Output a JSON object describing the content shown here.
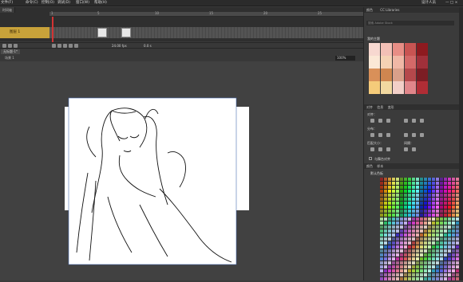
{
  "menubar": {
    "items": [
      "文件(F)",
      "命令(C)",
      "控制(O)",
      "调试(D)",
      "窗口(W)",
      "帮助(H)"
    ],
    "right_label": "设计人员"
  },
  "timeline": {
    "tab_label": "时间轴",
    "ruler_numbers": [
      "1",
      "5",
      "10",
      "15",
      "20",
      "25"
    ],
    "layer_name": "图层 1",
    "fps": "24.00 fps",
    "time": "0.0 s"
  },
  "scene": {
    "tab_label": "无标题-1*",
    "breadcrumb": "场景 1",
    "zoom": "100%"
  },
  "right_panel": {
    "library_tabs": [
      "颜色",
      "CC Libraries"
    ],
    "search_placeholder": "搜索 Adobe Stock",
    "palette_title": "我的主题",
    "align_tabs": [
      "对齐",
      "信息",
      "变形"
    ],
    "align_labels": [
      "对齐：",
      "分布：",
      "匹配大小：",
      "间隔："
    ],
    "align_checkbox": "与舞台对齐",
    "swatches_tabs": [
      "颜色",
      "样本"
    ],
    "swatches_title": "默认色板"
  },
  "colors": {
    "palette": [
      [
        "#f7d8d0",
        "#f3c0b6",
        "#e88e86",
        "#c95452",
        "#8e1a1f"
      ],
      [
        "#fbe8d6",
        "#f5d2b4",
        "#f0b8a6",
        "#d46968",
        "#a0303a"
      ],
      [
        "#d99059",
        "#cf8650",
        "#d9a08a",
        "#b5484b",
        "#7c1d24"
      ],
      [
        "#f5cb7a",
        "#f1d8a0",
        "#f2cfc8",
        "#e0868a",
        "#b02d35"
      ]
    ]
  }
}
